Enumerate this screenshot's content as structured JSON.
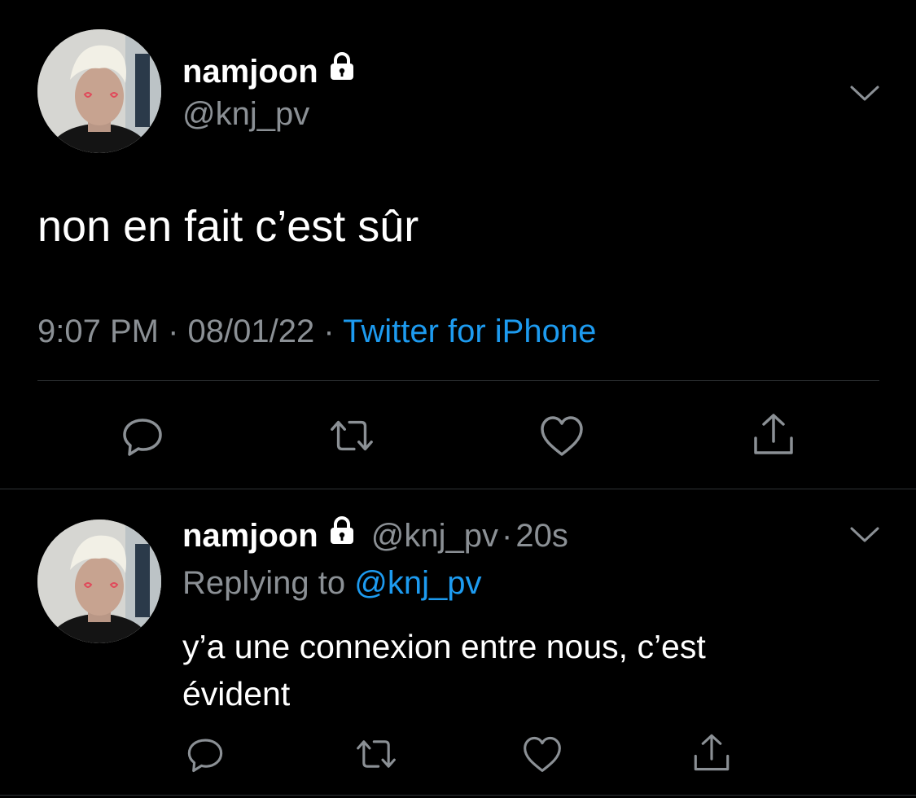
{
  "main_tweet": {
    "display_name": "namjoon",
    "handle": "@knj_pv",
    "text": "non en fait c’est sûr",
    "time": "9:07 PM",
    "date": "08/01/22",
    "source": "Twitter for iPhone",
    "separator": "·"
  },
  "reply_tweet": {
    "display_name": "namjoon",
    "handle": "@knj_pv",
    "age": "20s",
    "separator": "·",
    "replying_prefix": "Replying to",
    "replying_handle": "@knj_pv",
    "text_line1": "y’a une connexion entre nous, c’est",
    "text_line2": "évident"
  },
  "icons": {
    "lock": "lock-icon",
    "chevron": "chevron-down-icon",
    "reply": "reply-icon",
    "retweet": "retweet-icon",
    "like": "heart-icon",
    "share": "share-icon"
  },
  "colors": {
    "background": "#000000",
    "text": "#e7e9ea",
    "muted": "#8b9095",
    "link": "#1d9bf0",
    "divider": "#2f3336"
  }
}
